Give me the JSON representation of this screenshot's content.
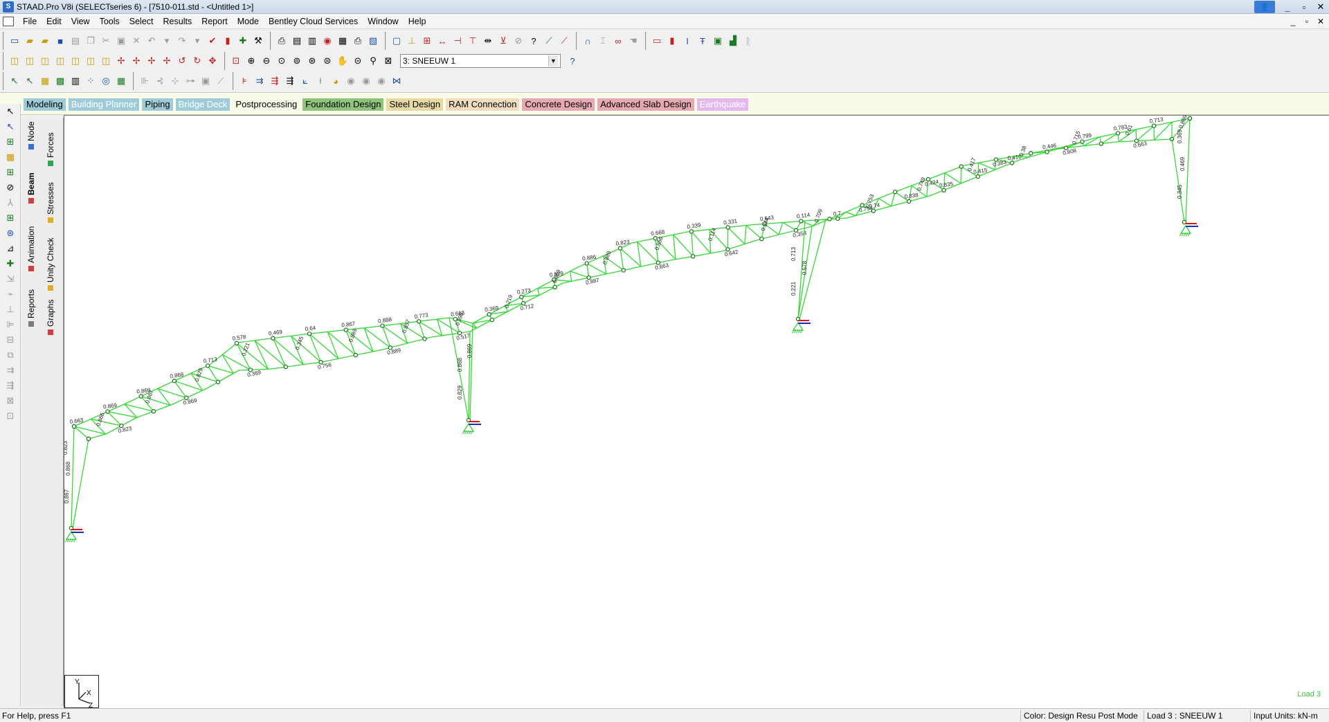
{
  "titlebar": {
    "title": "STAAD.Pro V8i (SELECTseries 6) - [7510-011.std - <Untitled 1>]",
    "controls": {
      "minimize": "_",
      "restore": "▫",
      "close": "✕"
    }
  },
  "menubar": {
    "items": [
      "File",
      "Edit",
      "View",
      "Tools",
      "Select",
      "Results",
      "Report",
      "Mode",
      "Bentley Cloud Services",
      "Window",
      "Help"
    ]
  },
  "toolbar": {
    "load_case_selected": "3: SNEEUW 1"
  },
  "mode_tabs": [
    {
      "label": "Modeling",
      "bg": "#9ecbd8"
    },
    {
      "label": "Building Planner",
      "bg": "#9ecbd8",
      "fg": "#ffffff"
    },
    {
      "label": "Piping",
      "bg": "#9ecbd8"
    },
    {
      "label": "Bridge Deck",
      "bg": "#9ecbd8",
      "fg": "#ffffff"
    },
    {
      "label": "Postprocessing",
      "bg": "transparent"
    },
    {
      "label": "Foundation Design",
      "bg": "#8fc27a"
    },
    {
      "label": "Steel Design",
      "bg": "#e7d9a1"
    },
    {
      "label": "RAM Connection",
      "bg": "#f1dcc0"
    },
    {
      "label": "Concrete Design",
      "bg": "#e6a9b4"
    },
    {
      "label": "Advanced Slab Design",
      "bg": "#e6a9b4"
    },
    {
      "label": "Earthquake",
      "bg": "#e6b7ee",
      "fg": "#ffffff"
    }
  ],
  "side_tabs": {
    "left": [
      "Node",
      "Beam",
      "Animation",
      "Reports"
    ],
    "right": [
      "Forces",
      "Stresses",
      "Unity Check",
      "Graphs"
    ]
  },
  "viewport": {
    "load_label": "Load 3",
    "axis_labels": {
      "y": "Y",
      "x": "X",
      "z": "Z"
    },
    "colors": {
      "members": "#32d832",
      "nodes": "#1a6b1a",
      "labels": "#202020",
      "support": "#26c826"
    }
  },
  "chart_data": {
    "type": "diagram",
    "title": "",
    "unity_check_labels": [
      "0.663",
      "0.866",
      "0.869",
      "0.823",
      "0.868",
      "0.867",
      "0.868",
      "0.869",
      "0.829",
      "0.713",
      "0.578",
      "0.221",
      "0.369",
      "0.469",
      "0.345",
      "0.64",
      "0.756",
      "0.867",
      "0.869",
      "0.888",
      "0.889",
      "0.857",
      "0.773",
      "0.663",
      "0.398",
      "0.517",
      "0.369",
      "0.219",
      "0.273",
      "0.712",
      "0.829",
      "0.869",
      "0.886",
      "0.887",
      "0.889",
      "0.823",
      "0.668",
      "0.856",
      "0.663",
      "0.339",
      "0.114",
      "0.331",
      "0.642",
      "0.643",
      "0.344",
      "0.114",
      "0.353",
      "0.709",
      "0.7",
      "0.74",
      "0.753",
      "0.754",
      "0.838",
      "0.749",
      "0.835",
      "0.424",
      "0.415",
      "0.417",
      "0.416",
      "0.383",
      "0.38",
      "0.446",
      "0.799",
      "0.715",
      "0.808",
      "0.783",
      "0.61",
      "0.713"
    ]
  },
  "statusbar": {
    "help": "For Help, press F1",
    "color_mode": "Color: Design Resu Post Mode",
    "load": "Load 3 : SNEEUW 1",
    "units": "Input Units:  kN-m"
  }
}
